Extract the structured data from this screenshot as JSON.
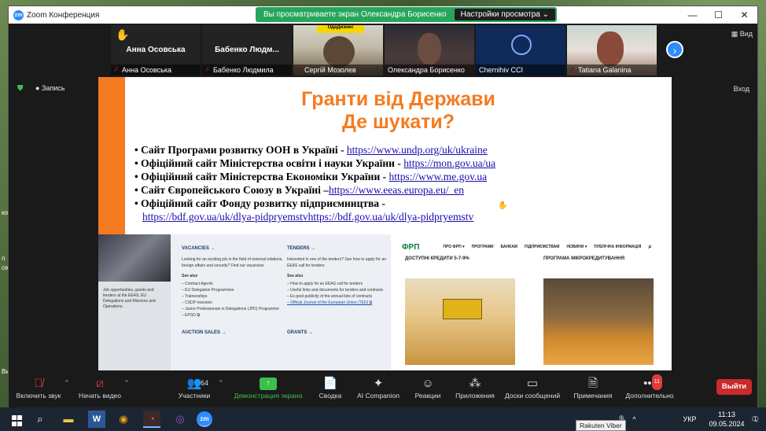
{
  "window": {
    "title": "Zoom Конференция",
    "share_message": "Вы просматриваете экран Олександра Борисенко",
    "view_settings": "Настройки просмотра",
    "minimize": "—",
    "maximize": "☐",
    "close": "✕"
  },
  "participants": [
    {
      "big_name": "Анна Осовська",
      "name": "Анна Осовська",
      "hand": true
    },
    {
      "big_name": "Бабенко  Людм...",
      "name": "Бабенко Людмила"
    },
    {
      "name": "Сергій Мозолев",
      "sign": "ОдаДизнес"
    },
    {
      "name": "Олександра Борисенко"
    },
    {
      "name": "Chernihiv CCI"
    },
    {
      "name": "Tatiana  Galanina"
    }
  ],
  "view_label": "Вид",
  "recording_label": "Запись",
  "exit_share_label": "Вход",
  "slide": {
    "title_line1": "Гранти від Держави",
    "title_line2": "Де шукати?",
    "bullets": [
      {
        "text": "• Сайт Програми розвитку ООН в Україні - ",
        "link": "https://www.undp.org/uk/ukraine"
      },
      {
        "text": "• Офіційний сайт Міністерства освіти і науки України - ",
        "link": "https://mon.gov.ua/ua"
      },
      {
        "text": "• Офіційний сайт Міністерства Економіки України - ",
        "link": "https://www.me.gov.ua"
      },
      {
        "text": "• Сайт Європейського Союзу в Україні –",
        "link": "https://www.eeas.europa.eu/_en"
      },
      {
        "text": "• Офіційний сайт Фонду розвитку підприємництва - ",
        "link": ""
      }
    ],
    "bullet5_link": "https://bdf.gov.ua/uk/dlya-pidpryemstvhttps://bdf.gov.ua/uk/dlya-pidpryemstv"
  },
  "eeas": {
    "side_text": "Job opportunities, grants and tenders at the EEAS, EU Delegations and Missions and Operations.",
    "vacancies": {
      "heading": "VACANCIES →",
      "intro": "Looking for an exciting job in the field of external relations, foreign affairs and security? Find our vacancies",
      "see_also": "See also",
      "items": [
        "– Contract Agents",
        "– EU Delegation Programmes",
        "– Traineeships",
        "– CSDP missions",
        "– Junior Professionals in Delegations (JPD) Programme",
        "– EPSO ⧉"
      ],
      "footer": "AUCTION SALES →"
    },
    "tenders": {
      "heading": "TENDERS →",
      "intro": "Interested in one of the tenders? See how to apply for an EEAS call for tenders",
      "see_also": "See also",
      "items": [
        "– How to apply for an EEAS call for tenders",
        "– Useful links and documents for tenders and contracts",
        "– Ex-post publicity of the annual lists of contracts"
      ],
      "link_item": "– Official Journal of the European Union (TED) ⧉",
      "footer": "GRANTS →"
    }
  },
  "bdf": {
    "logo": "ФРП",
    "nav": [
      "ПРО ФРП ▾",
      "ПРОГРАМИ",
      "БАНКАМ",
      "ПІДПРИЄМСТВАМ",
      "НОВИНИ ▾",
      "ПУБЛІЧНА ІНФОРМАЦІЯ"
    ],
    "search_icon": "⌕",
    "cap1": "ДОСТУПНІ КРЕДИТИ 5-7-9%",
    "cap2": "ПРОГРАМА МІКРОКРЕДИТУВАННЯ"
  },
  "toolbar": {
    "audio": "Включить звук",
    "video": "Начать видео",
    "participants": "Участники",
    "participants_count": "64",
    "share": "Демонстрация экрана",
    "summary": "Сводка",
    "ai": "AI Companion",
    "reactions": "Реакции",
    "apps": "Приложения",
    "whiteboards": "Доски сообщений",
    "notes": "Примечания",
    "more": "Дополнительно",
    "more_badge": "11",
    "exit": "Выйти"
  },
  "taskbar": {
    "time": "11:13",
    "date": "09.05.2024",
    "lang": "УКР",
    "tooltip": "Rakuten Viber",
    "notif": "1"
  },
  "edge_text": {
    "left1": "ко",
    "left2": "п",
    "left3": "се",
    "left4": "Ви"
  }
}
